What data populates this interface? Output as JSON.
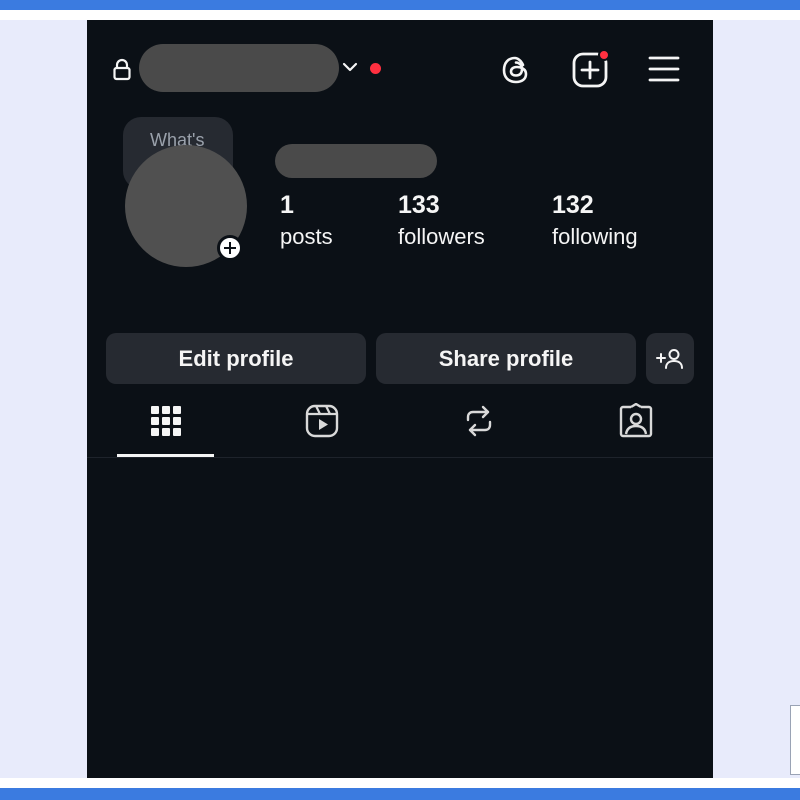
{
  "profile": {
    "note": "What's",
    "stats": {
      "posts": {
        "count": "1",
        "label": "posts"
      },
      "followers": {
        "count": "133",
        "label": "followers"
      },
      "following": {
        "count": "132",
        "label": "following"
      }
    }
  },
  "actions": {
    "edit_label": "Edit profile",
    "share_label": "Share profile"
  },
  "icons": {
    "header": [
      "lock-icon",
      "chevron-down-icon",
      "threads-icon",
      "create-post-icon",
      "menu-icon"
    ],
    "tabs": [
      "grid-icon",
      "reels-icon",
      "reposts-icon",
      "tagged-icon"
    ],
    "buttons": [
      "add-person-icon"
    ]
  },
  "colors": {
    "background": "#0b1016",
    "surface": "#262a31",
    "text": "#f5f5f5",
    "notification": "#ff3040",
    "frame_accent": "#3b7be0"
  }
}
